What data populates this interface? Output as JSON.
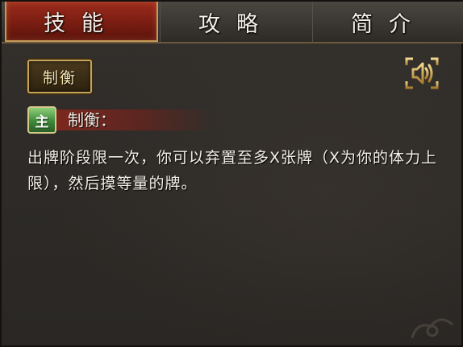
{
  "tabs": [
    {
      "label": "技能",
      "active": true
    },
    {
      "label": "攻略",
      "active": false
    },
    {
      "label": "简介",
      "active": false
    }
  ],
  "skill_button": {
    "label": "制衡"
  },
  "sound_button": {
    "icon": "speaker-icon"
  },
  "skill": {
    "type_badge": "主",
    "name": "制衡：",
    "description": "出牌阶段限一次，你可以弃置至多X张牌（X为你的体力上限），然后摸等量的牌。"
  },
  "colors": {
    "active_tab": "#7a1d12",
    "gold_border": "#c8a45a",
    "badge_green": "#3f8a3a",
    "background": "#2e2b28"
  }
}
